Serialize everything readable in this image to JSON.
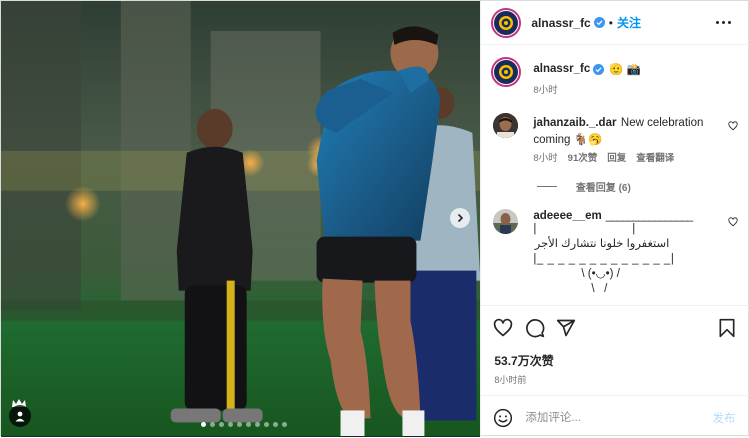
{
  "header": {
    "username": "alnassr_fc",
    "separator": "•",
    "follow_label": "关注"
  },
  "caption": {
    "username": "alnassr_fc",
    "text": "🫡 📸",
    "time": "8小时"
  },
  "comments": [
    {
      "username": "jahanzaib._.dar",
      "text": "New celebration coming 🐐🥱",
      "time": "8小时",
      "likes": "91次赞",
      "reply_label": "回复",
      "translate_label": "查看翻译",
      "view_replies": "查看回复 (6)"
    },
    {
      "username": "adeeee__em",
      "text_lines": [
        "________________",
        "|                              |",
        "استغفروا خلونا نتشارك الأجر",
        "|_ _ _ _ _ _ _ _ _ _ _ _ _|",
        "\\ (•◡•) /",
        "\\   /"
      ]
    }
  ],
  "actions": {
    "likes_count": "53.7万次赞",
    "posted_time": "8小时前"
  },
  "composer": {
    "placeholder": "添加评论...",
    "post_label": "发布"
  },
  "media": {
    "slide_count": 10,
    "active_slide": 0
  },
  "colors": {
    "link": "#0095f6",
    "verified": "#3897f0",
    "muted": "#737373",
    "post_disabled": "#b2dffc",
    "alnassr_navy": "#1b2a5b",
    "alnassr_gold": "#f2c200"
  }
}
